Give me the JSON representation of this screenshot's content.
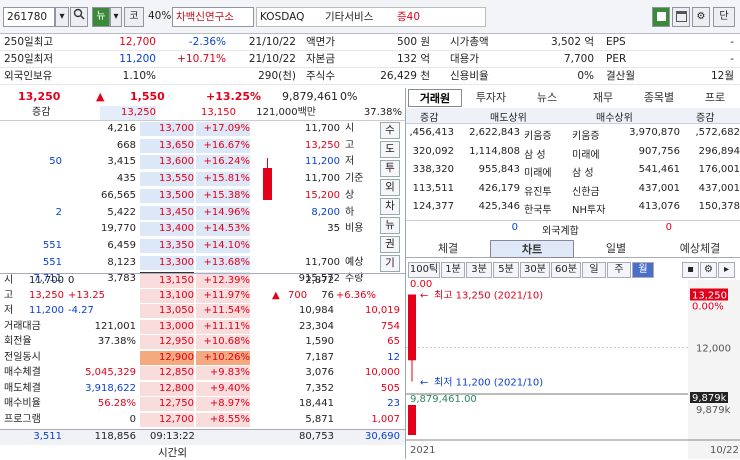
{
  "toolbar": {
    "code": "261780",
    "search_icon": "magnifier",
    "news_label": "뉴",
    "news_suffix": "-",
    "coin_label": "코",
    "ratio": "40%",
    "name": "차백신연구소",
    "market": "KOSDAQ",
    "sector": "기타서비스",
    "margin": "증40",
    "right_buttons": [
      "square-icon",
      "window-icon",
      "gear-icon",
      "단"
    ]
  },
  "info": {
    "rows": [
      {
        "l1": "250일최고",
        "v1": "12,700",
        "p1": "-2.36%",
        "d1": "21/10/22",
        "l2": "액면가",
        "v2": "500 원",
        "l3": "시가총액",
        "v3": "3,502 억",
        "l4": "EPS",
        "v4": "-"
      },
      {
        "l1": "250일최저",
        "v1": "11,200",
        "p1": "+10.71%",
        "d1": "21/10/22",
        "l2": "자본금",
        "v2": "132 억",
        "l3": "대용가",
        "v3": "7,700",
        "l4": "PER",
        "v4": "-"
      },
      {
        "l1": "외국인보유",
        "v1": "1.10%",
        "p1": "",
        "d1": "290(천)",
        "l2": "주식수",
        "v2": "26,429 천",
        "l3": "신용비율",
        "v3": "0%",
        "l4": "결산월",
        "v4": "12월"
      }
    ]
  },
  "quote": {
    "price": "13,250",
    "change": "1,550",
    "rate": "+13.25%",
    "volume": "9,879,461",
    "vol_unit": "0%",
    "sub_label": "증감",
    "sub_price1": "13,250",
    "sub_price2": "13,150",
    "sub_amount": "121,000백만",
    "sub_ratio": "37.38%"
  },
  "asks": [
    {
      "chg": "",
      "qty": "4,216",
      "price": "13,700",
      "pct": "+17.09%"
    },
    {
      "chg": "",
      "qty": "668",
      "price": "13,650",
      "pct": "+16.67%"
    },
    {
      "chg": "50",
      "qty": "3,415",
      "price": "13,600",
      "pct": "+16.24%"
    },
    {
      "chg": "",
      "qty": "435",
      "price": "13,550",
      "pct": "+15.81%"
    },
    {
      "chg": "",
      "qty": "66,565",
      "price": "13,500",
      "pct": "+15.38%"
    },
    {
      "chg": "2",
      "qty": "5,422",
      "price": "13,450",
      "pct": "+14.96%"
    },
    {
      "chg": "",
      "qty": "19,770",
      "price": "13,400",
      "pct": "+14.53%"
    },
    {
      "chg": "551",
      "qty": "6,459",
      "price": "13,350",
      "pct": "+14.10%"
    },
    {
      "chg": "551",
      "qty": "8,123",
      "price": "13,300",
      "pct": "+13.68%"
    },
    {
      "chg": "7,711",
      "qty": "3,783",
      "price": "13,250",
      "pct": "+13.25%"
    }
  ],
  "ask_info": [
    {
      "v": "11,700",
      "l": "시"
    },
    {
      "v": "13,250",
      "l": "고"
    },
    {
      "v": "11,200",
      "l": "저"
    },
    {
      "v": "11,700",
      "l": "기준"
    },
    {
      "v": "15,200",
      "l": "상"
    },
    {
      "v": "8,200",
      "l": "하"
    },
    {
      "v": "35",
      "l": "비용"
    },
    {
      "v": "",
      "l": ""
    },
    {
      "v": "11,700",
      "l": "예상"
    },
    {
      "v": "915,572",
      "l": "수량"
    }
  ],
  "expect": {
    "mark": "▲",
    "chg": "700",
    "pct": "+6.36%"
  },
  "side_tabs": [
    "수",
    "도",
    "투",
    "외",
    "차",
    "뉴",
    "권",
    "기"
  ],
  "bids": [
    {
      "price": "13,150",
      "pct": "+12.39%",
      "qty": "2,872",
      "chg": ""
    },
    {
      "price": "13,100",
      "pct": "+11.97%",
      "qty": "76",
      "chg": ""
    },
    {
      "price": "13,050",
      "pct": "+11.54%",
      "qty": "10,984",
      "chg": "10,019"
    },
    {
      "price": "13,000",
      "pct": "+11.11%",
      "qty": "23,304",
      "chg": "754"
    },
    {
      "price": "12,950",
      "pct": "+10.68%",
      "qty": "1,590",
      "chg": "65"
    },
    {
      "price": "12,900",
      "pct": "+10.26%",
      "qty": "7,187",
      "chg": "12"
    },
    {
      "price": "12,850",
      "pct": "+9.83%",
      "qty": "3,076",
      "chg": "10,000"
    },
    {
      "price": "12,800",
      "pct": "+9.40%",
      "qty": "7,352",
      "chg": "505"
    },
    {
      "price": "12,750",
      "pct": "+8.97%",
      "qty": "18,441",
      "chg": "23"
    },
    {
      "price": "12,700",
      "pct": "+8.55%",
      "qty": "5,871",
      "chg": "1,007"
    }
  ],
  "bid_info": [
    {
      "l": "시",
      "v": "11,700",
      "x": "0"
    },
    {
      "l": "고",
      "v": "13,250",
      "x": "+13.25"
    },
    {
      "l": "저",
      "v": "11,200",
      "x": "-4.27"
    },
    {
      "l": "거래대금",
      "v": "121,001",
      "x": ""
    },
    {
      "l": "회전율",
      "v": "37.38%",
      "x": ""
    },
    {
      "l": "전일동시",
      "v": "",
      "x": ""
    },
    {
      "l": "매수체결",
      "v": "5,045,329",
      "x": ""
    },
    {
      "l": "매도체결",
      "v": "3,918,622",
      "x": ""
    },
    {
      "l": "매수비율",
      "v": "56.28%",
      "x": ""
    },
    {
      "l": "프로그램",
      "v": "0",
      "x": ""
    }
  ],
  "footer": {
    "ask_total": "3,511",
    "ask_qty": "118,856",
    "time": "09:13:22",
    "time_label": "시간외",
    "bid_qty": "80,753",
    "bid_total": "30,690"
  },
  "right_tabs": [
    "거래원",
    "투자자",
    "뉴스",
    "재무",
    "종목별",
    "프로"
  ],
  "broker": {
    "sell_hdr": "매도상위",
    "buy_hdr": "매수상위",
    "chg_hdr": "증감",
    "rows": [
      {
        "a": ",456,413",
        "b": "2,622,843",
        "c": "키움증",
        "d": "키움증",
        "e": "3,970,870",
        "f": ",572,682"
      },
      {
        "a": "320,092",
        "b": "1,114,808",
        "c": "삼 성",
        "d": "미래에",
        "e": "907,756",
        "f": "296,894"
      },
      {
        "a": "338,320",
        "b": "955,843",
        "c": "미래에",
        "d": "삼 성",
        "e": "541,461",
        "f": "176,001"
      },
      {
        "a": "113,511",
        "b": "426,179",
        "c": "유진투",
        "d": "신한금",
        "e": "437,001",
        "f": "437,001"
      },
      {
        "a": "124,377",
        "b": "425,346",
        "c": "한국투",
        "d": "NH투자",
        "e": "413,076",
        "f": "150,378"
      }
    ],
    "foreign_label": "외국계합",
    "foreign_sell": "0",
    "foreign_buy": "0"
  },
  "chart_tabs": [
    "체결",
    "차트",
    "일별",
    "예상체결"
  ],
  "period_tabs": [
    "100틱",
    "1분",
    "3분",
    "5분",
    "30분",
    "60분",
    "일",
    "주",
    "월"
  ],
  "chart": {
    "ref": "0.00",
    "ref_pct": "0.00%",
    "high_label": "최고 13,250 (2021/10)",
    "low_label": "최저 11,200 (2021/10)",
    "vol_label": "9,879,461.00",
    "tag_price": "13,250",
    "tag_pct": "0.00%",
    "axis_12000": "12,000",
    "tag_vol": "9,879k",
    "axis_vol": "9,879k",
    "year": "2021",
    "date": "10/22"
  },
  "chart_data": {
    "type": "bar",
    "categories": [
      "2021/10"
    ],
    "open": [
      11700
    ],
    "high": [
      13250
    ],
    "low": [
      11200
    ],
    "close": [
      13250
    ],
    "volume": [
      9879461
    ]
  }
}
